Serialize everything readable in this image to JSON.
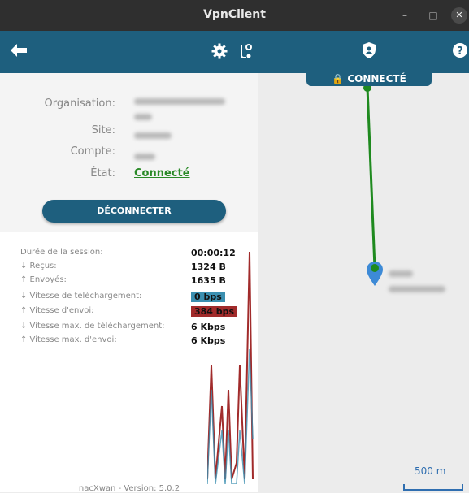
{
  "window": {
    "title": "VpnClient"
  },
  "toolbar": {
    "connected_label": "CONNECTÉ"
  },
  "connection": {
    "organisation_label": "Organisation:",
    "site_label": "Site:",
    "compte_label": "Compte:",
    "etat_label": "État:",
    "etat_value": "Connecté",
    "disconnect_label": "DÉCONNECTER"
  },
  "stats": [
    {
      "label": "Durée de la session:",
      "value": "00:00:12",
      "style": "plain"
    },
    {
      "label": "↓ Reçus:",
      "value": "1324 B",
      "style": "plain"
    },
    {
      "label": "↑ Envoyés:",
      "value": "1635 B",
      "style": "plain"
    },
    {
      "label": "↓ Vitesse de téléchargement:",
      "value": "0 bps",
      "style": "download"
    },
    {
      "label": "↑ Vitesse d'envoi:",
      "value": "384 bps",
      "style": "upload"
    },
    {
      "label": "↓ Vitesse max. de téléchargement:",
      "value": "6 Kbps",
      "style": "plain"
    },
    {
      "label": "↑ Vitesse max. d'envoi:",
      "value": "6 Kbps",
      "style": "plain"
    }
  ],
  "colors": {
    "accent": "#1e5f7e",
    "download": "#3b8fb0",
    "upload": "#a12b2b",
    "connected_green": "#2a8a27",
    "route_line": "#1f8a1f"
  },
  "footer": {
    "version": "nacXwan - Version: 5.0.2"
  },
  "map": {
    "scale_label": "500 m"
  },
  "icons": [
    "back-arrow-icon",
    "gear-icon",
    "route-icon",
    "shield-icon",
    "help-icon",
    "lock-icon",
    "location-pin-icon"
  ]
}
